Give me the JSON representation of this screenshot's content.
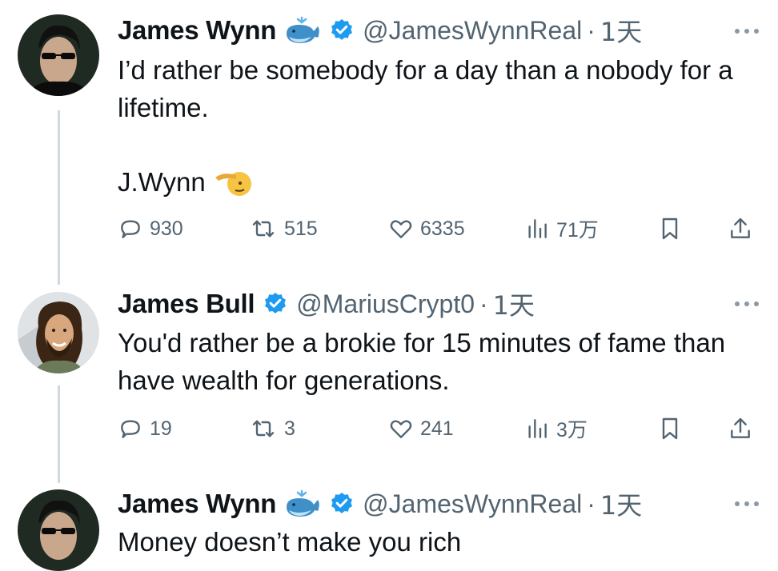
{
  "tweets": [
    {
      "name": "James Wynn",
      "handle": "@JamesWynnReal",
      "separator": "·",
      "time": "1天",
      "text": "I’d rather be somebody for a day than a nobody for a lifetime.",
      "signature": "J.Wynn",
      "stats": {
        "replies": "930",
        "retweets": "515",
        "likes": "6335",
        "views": "71万"
      }
    },
    {
      "name": "James Bull",
      "handle": "@MariusCrypt0",
      "separator": "·",
      "time": "1天",
      "text": "You'd rather be a brokie for 15 minutes of fame than have wealth for generations.",
      "stats": {
        "replies": "19",
        "retweets": "3",
        "likes": "241",
        "views": "3万"
      }
    },
    {
      "name": "James Wynn",
      "handle": "@JamesWynnReal",
      "separator": "·",
      "time": "1天",
      "text": "Money doesn’t make you rich"
    }
  ],
  "icons": {
    "name_emoji": "whale-icon",
    "verified": "verified-badge-icon",
    "signature_emoji": "saluting-face-icon",
    "reply": "reply-icon",
    "retweet": "retweet-icon",
    "like": "heart-icon",
    "views": "views-icon",
    "bookmark": "bookmark-icon",
    "share": "share-icon",
    "more": "more-icon"
  },
  "colors": {
    "text": "#0f1419",
    "secondary": "#536471",
    "verified": "#1d9bf0",
    "thread_line": "#cfd9de"
  }
}
